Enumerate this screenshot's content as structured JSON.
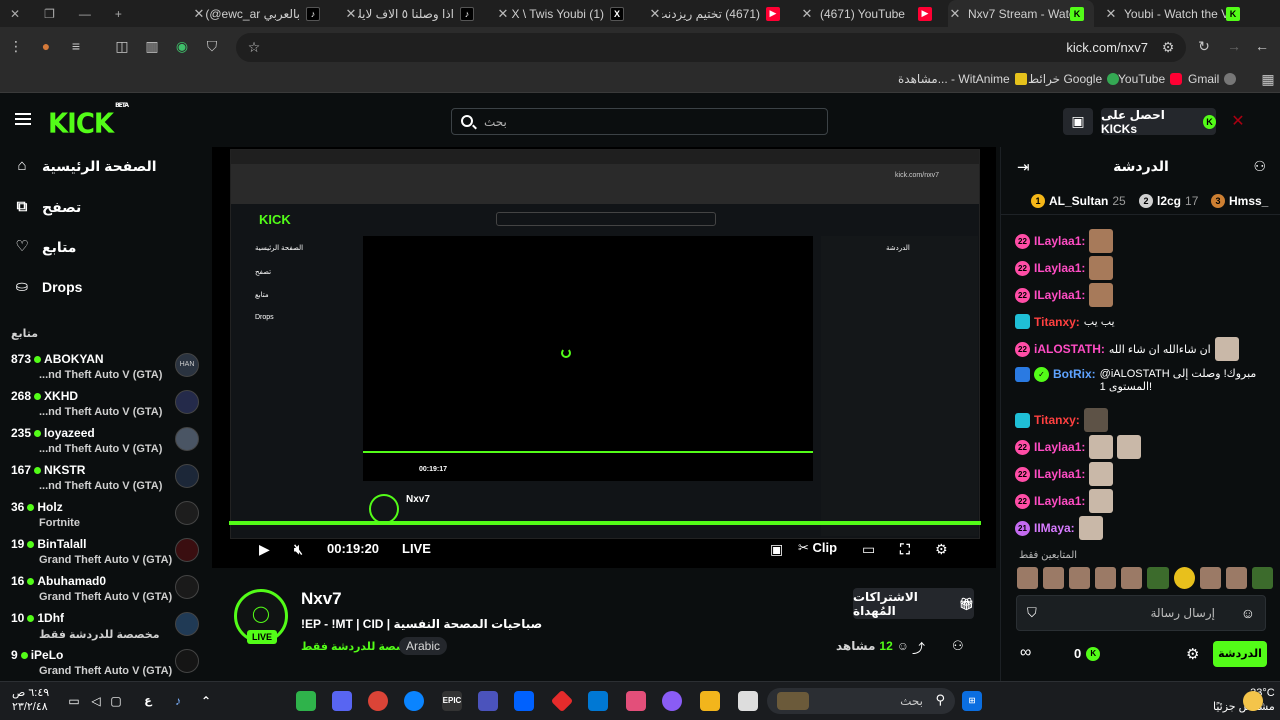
{
  "browser": {
    "tabs": [
      {
        "label": "بالعربي EWC (@ewc_ar",
        "icon": "tiktok-icon"
      },
      {
        "label": "اذا وصلنا ٥ الاف لايك",
        "icon": "tiktok-icon"
      },
      {
        "label": "(1) X \\ Twis Youbi (@",
        "icon": "x-icon"
      },
      {
        "label": "(4671) تختيم ريزدنت",
        "icon": "youtube-icon"
      },
      {
        "label": "(4671) YouTube",
        "icon": "youtube-icon"
      },
      {
        "label": "Nxv7 Stream - Watch",
        "icon": "kick-icon"
      },
      {
        "label": "Youbi - Watch the V",
        "icon": "kick-icon"
      }
    ],
    "url": "kick.com/nxv7",
    "bookmarks": [
      "Gmail",
      "YouTube",
      "خرائط Google",
      "مشاهدة... - WitAnime"
    ]
  },
  "header": {
    "logo": "KICK",
    "logo_sup": "BETA",
    "search_placeholder": "بحث",
    "get_kicks": "احصل على KICKs"
  },
  "sidebar": {
    "nav": [
      {
        "label": "الصفحة الرئيسية",
        "icon": "home-icon"
      },
      {
        "label": "تصفح",
        "icon": "browse-icon"
      },
      {
        "label": "متابع",
        "icon": "heart-icon"
      },
      {
        "label": "Drops",
        "icon": "drops-icon"
      }
    ],
    "following_title": "متابع",
    "channels": [
      {
        "viewers": "873",
        "name": "ABOKYAN",
        "game": "...nd Theft Auto V (GTA)"
      },
      {
        "viewers": "268",
        "name": "XKHD",
        "game": "...nd Theft Auto V (GTA)"
      },
      {
        "viewers": "235",
        "name": "loyazeed",
        "game": "...nd Theft Auto V (GTA)"
      },
      {
        "viewers": "167",
        "name": "NKSTR",
        "game": "...nd Theft Auto V (GTA)"
      },
      {
        "viewers": "36",
        "name": "Holz",
        "game": "Fortnite"
      },
      {
        "viewers": "19",
        "name": "BinTalall",
        "game": "Grand Theft Auto V (GTA)"
      },
      {
        "viewers": "16",
        "name": "Abuhamad0",
        "game": "Grand Theft Auto V (GTA)"
      },
      {
        "viewers": "10",
        "name": "1Dhf",
        "game": "مخصصة للدردشة فقط"
      },
      {
        "viewers": "9",
        "name": "iPeLo",
        "game": "Grand Theft Auto V (GTA)"
      }
    ]
  },
  "player": {
    "time": "00:19:20",
    "live": "LIVE",
    "clip": "Clip",
    "inner_time": "00:19:17"
  },
  "stream": {
    "streamer": "Nxv7",
    "live_badge": "LIVE",
    "title": "!EP - !MT | CID | صباحيات المصحة النفسية",
    "category": "مخصصة للدردشة فقط",
    "language": "Arabic",
    "subs_button": "الاشتراكات المُهداة",
    "viewers": "12",
    "viewers_label": "مشاهد"
  },
  "chat": {
    "title": "الدردشة",
    "leaders": [
      {
        "rank": "1",
        "name": "AL_Sultan",
        "points": "25"
      },
      {
        "rank": "2",
        "name": "l2cg",
        "points": "17"
      },
      {
        "rank": "3",
        "name": "Hmss_",
        "points": ""
      }
    ],
    "messages": [
      {
        "badge": "22",
        "user": "ILaylaa1:",
        "text": "",
        "emotes": 1
      },
      {
        "badge": "22",
        "user": "ILaylaa1:",
        "text": "",
        "emotes": 1
      },
      {
        "badge": "22",
        "user": "ILaylaa1:",
        "text": "",
        "emotes": 1
      },
      {
        "badge": "",
        "user": "Titanxy:",
        "text": "يب يب",
        "emotes": 0
      },
      {
        "badge": "22",
        "user": "iALOSTATH:",
        "text": "ان شاءالله ان شاء الله",
        "emotes": 1
      },
      {
        "badge": "",
        "user": "BotRix:",
        "text": "@iALOSTATH مبروك! وصلت إلى المستوى 1!",
        "emotes": 0
      },
      {
        "badge": "",
        "user": "Titanxy:",
        "text": "",
        "emotes": 1
      },
      {
        "badge": "22",
        "user": "ILaylaa1:",
        "text": "",
        "emotes": 2
      },
      {
        "badge": "22",
        "user": "ILaylaa1:",
        "text": "",
        "emotes": 1
      },
      {
        "badge": "22",
        "user": "ILaylaa1:",
        "text": "",
        "emotes": 1
      },
      {
        "badge": "21",
        "user": "IIMaya:",
        "text": "",
        "emotes": 1
      }
    ],
    "emote_label": "المتابعين فقط",
    "input_placeholder": "إرسال رسالة",
    "kicks": "0",
    "send": "الدردشة"
  },
  "taskbar": {
    "search_placeholder": "بحث",
    "weather_temp": "33°C",
    "weather_desc": "مشمس جزئيًا",
    "time": "٦:٤٩ ص",
    "date": "٢٣/٢/٤٨",
    "lang": "ع"
  },
  "colors": {
    "accent": "#53fc18",
    "background": "#0b0e0f",
    "chat_user": "#ff4dc4"
  }
}
